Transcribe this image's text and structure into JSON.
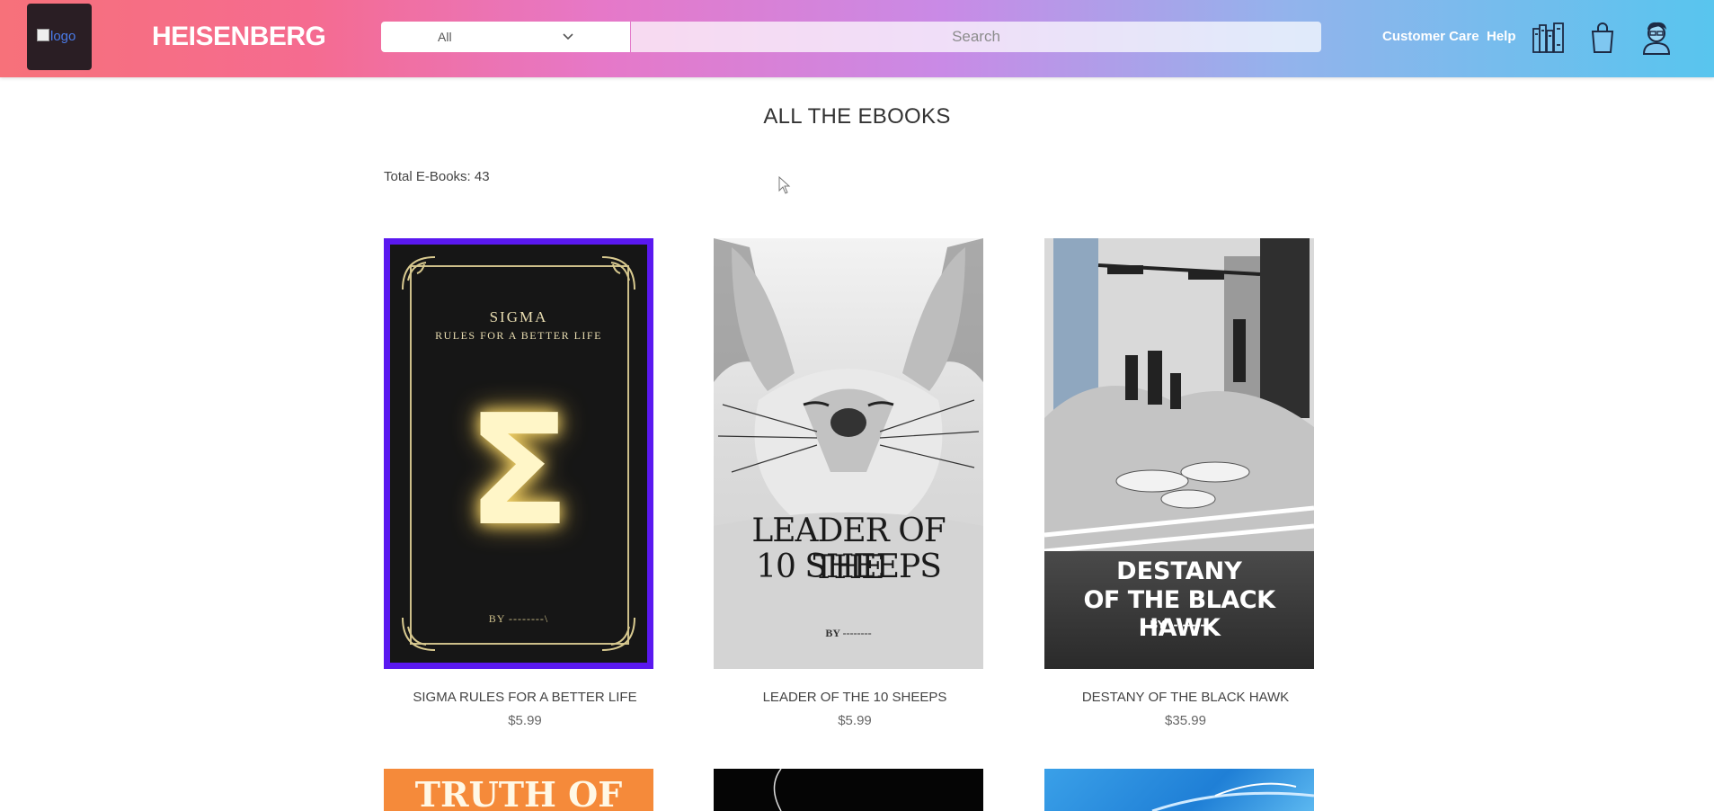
{
  "header": {
    "logo_alt": "logo",
    "brand": "HEISENBERG",
    "category_select": "All",
    "search_placeholder": "Search",
    "nav": {
      "customer_care": "Customer Care",
      "help": "Help"
    },
    "icons": [
      "library-icon",
      "shopping-bag-icon",
      "user-avatar-icon"
    ]
  },
  "main": {
    "title": "ALL THE EBOOKS",
    "total_label": "Total E-Books: 43"
  },
  "books": [
    {
      "title": "SIGMA RULES FOR A BETTER LIFE",
      "price": "$5.99",
      "cover": {
        "line1": "SIGMA",
        "line2": "RULES FOR A BETTER LIFE",
        "symbol": "Σ",
        "by": "BY --------\\"
      }
    },
    {
      "title": "LEADER OF THE 10 SHEEPS",
      "price": "$5.99",
      "cover": {
        "line1": "LEADER OF THE",
        "line2": "10 SHEEPS",
        "by": "BY --------"
      }
    },
    {
      "title": "DESTANY OF THE BLACK HAWK",
      "price": "$35.99",
      "cover": {
        "line1": "DESTANY",
        "line2": "OF THE BLACK HAWK",
        "by": "BY --------\\"
      }
    }
  ],
  "row2_covers": [
    {
      "text": "TRUTH OF"
    },
    {
      "text": ""
    },
    {
      "text": ""
    }
  ]
}
